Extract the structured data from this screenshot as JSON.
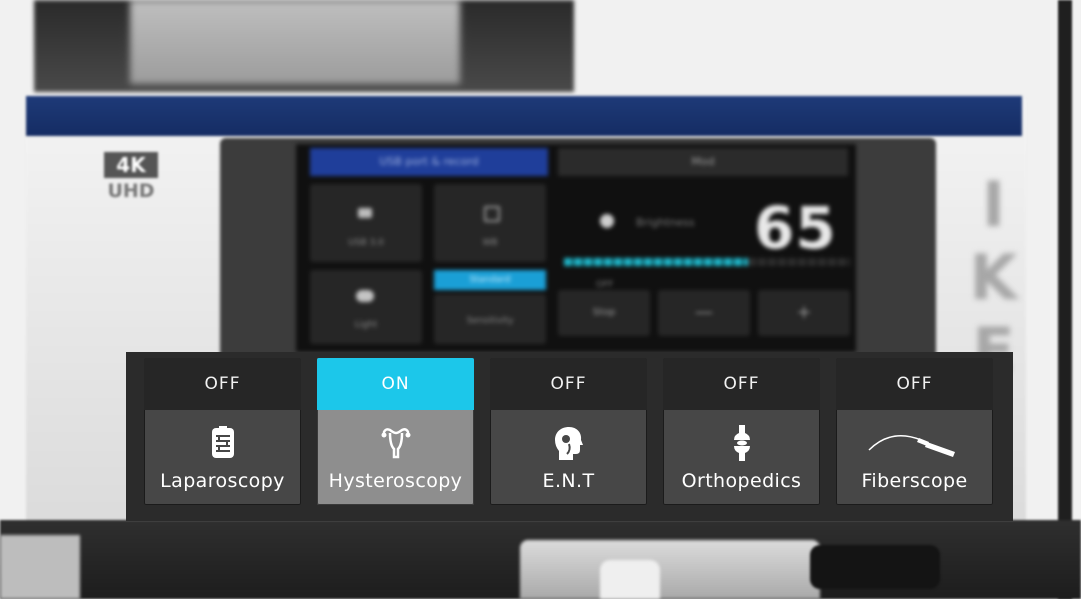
{
  "device": {
    "logo_top": "4K",
    "logo_bottom": "UHD",
    "brand": "IKE",
    "screen": {
      "top_left_tab": "USB port & record",
      "top_right_tab": "Mod",
      "tiles": [
        "USB 3.0",
        "WB",
        "Light",
        "Sensitivity"
      ],
      "highlight_tag": "Standard",
      "setting_label": "Brightness",
      "setting_value": "65",
      "setting_state": "OFF",
      "buttons": [
        "Stop",
        "—",
        "+"
      ]
    }
  },
  "modes_panel": {
    "accent_color": "#1cc7ea",
    "modes": [
      {
        "status": "OFF",
        "label": "Laparoscopy",
        "icon": "intestine-icon",
        "active": false
      },
      {
        "status": "ON",
        "label": "Hysteroscopy",
        "icon": "uterus-icon",
        "active": true
      },
      {
        "status": "OFF",
        "label": "E.N.T",
        "icon": "head-profile-icon",
        "active": false
      },
      {
        "status": "OFF",
        "label": "Orthopedics",
        "icon": "knee-joint-icon",
        "active": false
      },
      {
        "status": "OFF",
        "label": "Fiberscope",
        "icon": "fiberscope-icon",
        "active": false
      }
    ]
  }
}
